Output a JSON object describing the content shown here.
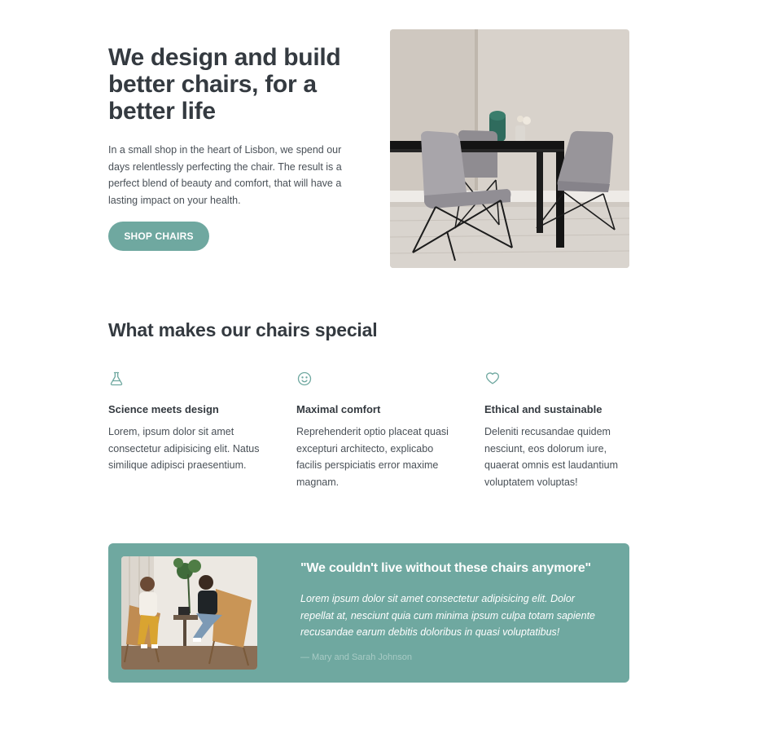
{
  "hero": {
    "title": "We design and build better chairs, for a better life",
    "text": "In a small shop in the heart of Lisbon, we spend our days relentlessly perfecting the chair. The result is a perfect blend of beauty and comfort, that will have a lasting impact on your health.",
    "button_label": "SHOP CHAIRS",
    "image_alt": "Grey chairs around a black dining table"
  },
  "features": {
    "title": "What makes our chairs special",
    "items": [
      {
        "icon": "flask-icon",
        "title": "Science meets design",
        "text": "Lorem, ipsum dolor sit amet consectetur adipisicing elit. Natus similique adipisci praesentium."
      },
      {
        "icon": "smiley-icon",
        "title": "Maximal comfort",
        "text": "Reprehenderit optio placeat quasi excepturi architecto, explicabo facilis perspiciatis error maxime magnam."
      },
      {
        "icon": "heart-icon",
        "title": "Ethical and sustainable",
        "text": "Deleniti recusandae quidem nesciunt, eos dolorum iure, quaerat omnis est laudantium voluptatem voluptas!"
      }
    ]
  },
  "testimonial": {
    "quote": "\"We couldn't live without these chairs anymore\"",
    "text": "Lorem ipsum dolor sit amet consectetur adipisicing elit. Dolor repellat at, nesciunt quia cum minima ipsum culpa totam sapiente recusandae earum debitis doloribus in quasi voluptatibus!",
    "author": "— Mary and Sarah Johnson",
    "image_alt": "Two women sitting in chairs"
  },
  "colors": {
    "accent": "#6fa8a0",
    "text_dark": "#343a40",
    "text_body": "#495057"
  }
}
